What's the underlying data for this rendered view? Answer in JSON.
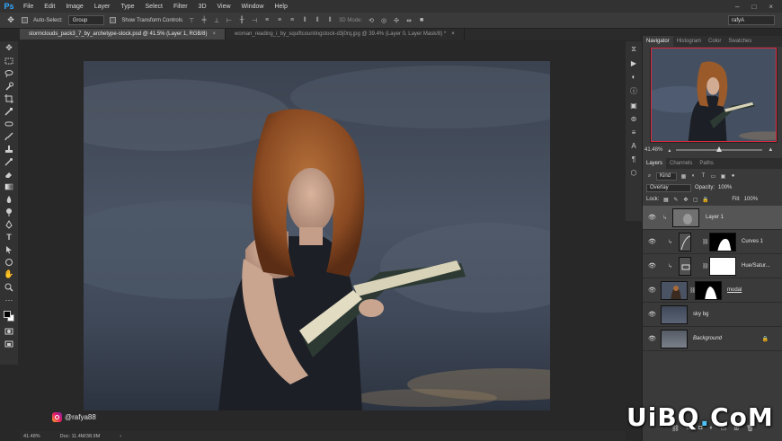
{
  "menu": {
    "logo": "Ps",
    "items": [
      "File",
      "Edit",
      "Image",
      "Layer",
      "Type",
      "Select",
      "Filter",
      "3D",
      "View",
      "Window",
      "Help"
    ]
  },
  "options": {
    "auto_select": "Auto-Select:",
    "group_value": "Group",
    "show_transform": "Show Transform Controls",
    "mode_3d": "3D Mode:",
    "workspace": "rafyA"
  },
  "tabs": [
    {
      "label": "stormclouds_pack3_7_by_archetype-stock.psd @ 41.5% (Layer 1, RGB/8)",
      "close": "×",
      "active": true
    },
    {
      "label": "woman_reading_i_by_squiftcountingstock-d3j0rq.jpg @ 39.4% (Layer 0, Layer Mask/8) *",
      "close": "×",
      "active": false
    }
  ],
  "watermark": {
    "handle": "@rafya88"
  },
  "status": {
    "zoom": "41.48%",
    "doc": "Doc: 11.4M/38.9M"
  },
  "navigator": {
    "tabs": [
      "Navigator",
      "Histogram",
      "Color",
      "Swatches"
    ],
    "zoom": "41.48%",
    "zoom_level": 0.5
  },
  "layers": {
    "tabs": [
      "Layers",
      "Channels",
      "Paths"
    ],
    "filter_kind": "Kind",
    "blend_mode": "Overlay",
    "opacity_label": "Opacity:",
    "opacity_value": "100%",
    "lock_label": "Lock:",
    "fill_label": "Fill:",
    "fill_value": "100%",
    "items": [
      {
        "name": "Layer 1",
        "selected": true
      },
      {
        "name": "Curves 1",
        "selected": false
      },
      {
        "name": "Hue/Satur...",
        "selected": false
      },
      {
        "name": "modal",
        "selected": false
      },
      {
        "name": "sky bg",
        "selected": false
      },
      {
        "name": "Background",
        "selected": false
      }
    ]
  },
  "site_watermark": {
    "text1": "UiBQ",
    "dot": ".",
    "text2": "CoM"
  },
  "colors": {
    "accent_blue": "#31a8ff",
    "nav_frame": "#e0293e",
    "panel_bg": "#3a3a3a"
  }
}
